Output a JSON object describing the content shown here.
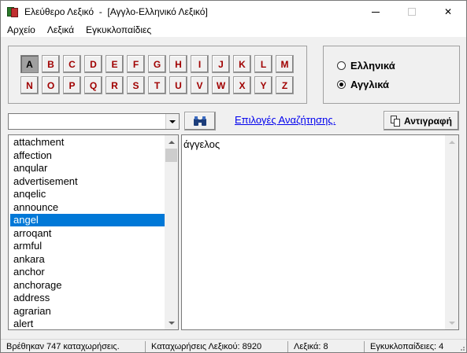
{
  "window": {
    "title": "Ελεύθερο Λεξικό  -  [Αγγλο-Ελληνικό Λεξικό]",
    "controls": {
      "minimize": "–",
      "maximize": "□",
      "close": "✕"
    }
  },
  "menu": [
    "Αρχείο",
    "Λεξικά",
    "Εγκυκλοπαίδιες"
  ],
  "letters": {
    "row1": [
      "A",
      "B",
      "C",
      "D",
      "E",
      "F",
      "G",
      "H",
      "I",
      "J",
      "K",
      "L",
      "M"
    ],
    "row2": [
      "N",
      "O",
      "P",
      "Q",
      "R",
      "S",
      "T",
      "U",
      "V",
      "W",
      "X",
      "Y",
      "Z"
    ],
    "active": "A"
  },
  "language": {
    "options": [
      {
        "label": "Ελληνικά",
        "checked": false
      },
      {
        "label": "Αγγλικά",
        "checked": true
      }
    ]
  },
  "search": {
    "value": "",
    "link_text": "Επιλογές Αναζήτησης.",
    "copy_label": "Αντιγραφή"
  },
  "wordlist": {
    "items": [
      "attachment",
      "affection",
      "anqular",
      "advertisement",
      "anqelic",
      "announce",
      "angel",
      "arroqant",
      "armful",
      "ankara",
      "anchor",
      "anchorage",
      "address",
      "agrarian",
      "alert"
    ],
    "selected_index": 6
  },
  "definition": {
    "text": "άγγελος"
  },
  "status": {
    "found": "Βρέθηκαν 747 καταχωρήσεις.",
    "entries": "Καταχωρήσεις Λεξικού: 8920",
    "dictionaries": "Λεξικά: 8",
    "encyclopedias": "Εγκυκλοπαίδειες: 4"
  },
  "colors": {
    "letter_text": "#a00000",
    "selection": "#0078d7",
    "link": "#0000ee"
  }
}
